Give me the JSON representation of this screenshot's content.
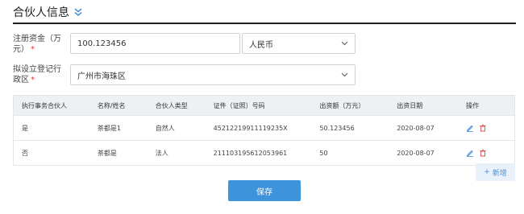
{
  "header": {
    "title": "合伙人信息"
  },
  "form": {
    "capital": {
      "label_line1": "注册资金（万",
      "label_line2": "元）",
      "value": "100.123456",
      "currency": "人民币"
    },
    "district": {
      "label_line1": "拟设立登记行",
      "label_line2": "政区",
      "value": "广州市海珠区"
    }
  },
  "table": {
    "headers": [
      "执行事务合伙人",
      "名称/姓名",
      "合伙人类型",
      "证件（证照）号码",
      "出资额（万元）",
      "出资日期",
      "操作"
    ],
    "rows": [
      [
        "是",
        "茶都是1",
        "自然人",
        "45212219911119235X",
        "50.123456",
        "2020-08-07"
      ],
      [
        "否",
        "茶都是",
        "法人",
        "211103195612053961",
        "50",
        "2020-08-07"
      ]
    ]
  },
  "buttons": {
    "add": "新增",
    "save": "保存"
  },
  "colors": {
    "accent": "#3d94db",
    "danger": "#e05555",
    "header_rule": "#1f1f1f"
  }
}
